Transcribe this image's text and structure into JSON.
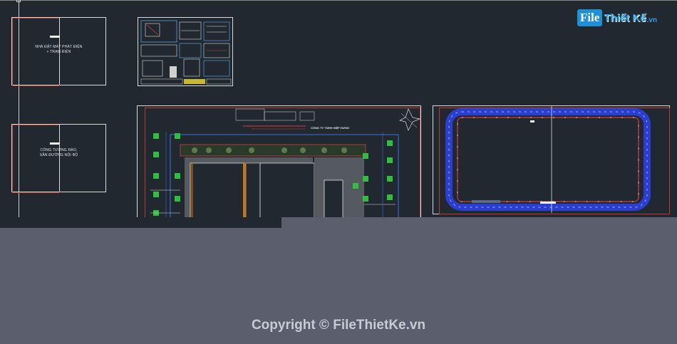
{
  "sheets": {
    "generator_house": {
      "label_line1": "NHÀ ĐẶT MÁY PHÁT ĐIỆN",
      "label_line2": "+ TRẠM ĐIỆN"
    },
    "gate_fence": {
      "label_line1": "CỔNG TƯỜNG RÀO,",
      "label_line2": "SÂN ĐƯỜNG NỘI BỘ"
    },
    "site_plan": {
      "title": "CÔNG TY TNHH HIỆP HƯNG"
    }
  },
  "watermark": {
    "logo_file": "File",
    "logo_rest": "Thiết Kế",
    "logo_tld": ".vn",
    "copyright": "Copyright © FileThietKe.vn"
  },
  "colors": {
    "cad_background": "#212830",
    "gutter": "#5a5e6d",
    "frame_red": "#c0392b",
    "brand_blue": "#29a3e8"
  }
}
